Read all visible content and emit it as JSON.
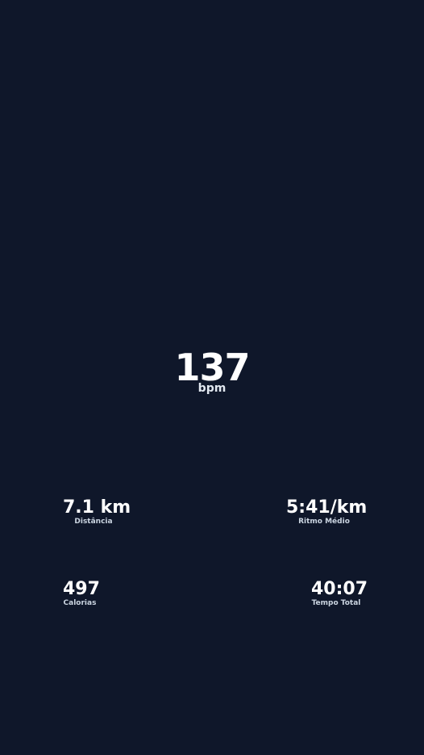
{
  "heart_rate": {
    "value": "137",
    "unit": "bpm"
  },
  "stats": {
    "distance": {
      "value": "7.1 km",
      "label": "Distância"
    },
    "pace": {
      "value": "5:41/km",
      "label": "Ritmo Médio"
    },
    "calories": {
      "value": "497",
      "label": "Calorias"
    },
    "time": {
      "value": "40:07",
      "label": "Tempo Total"
    }
  },
  "colors": {
    "background": "#0f172a",
    "text": "#ffffff",
    "label": "#cbd5e1"
  }
}
